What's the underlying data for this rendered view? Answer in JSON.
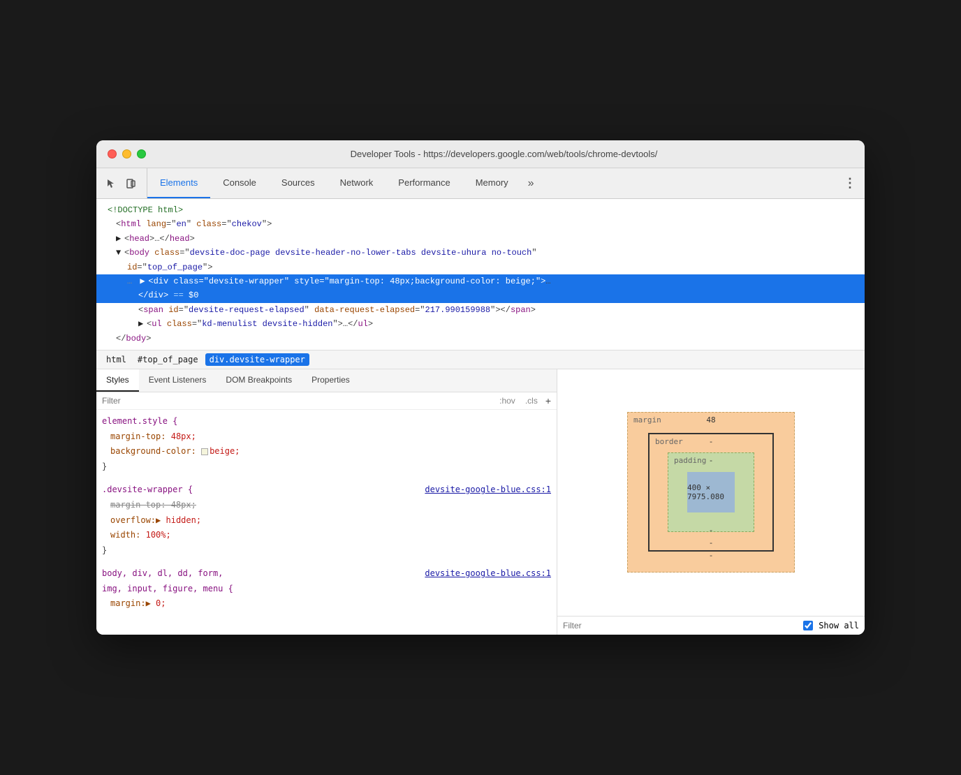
{
  "window": {
    "title": "Developer Tools - https://developers.google.com/web/tools/chrome-devtools/",
    "traffic_lights": [
      "close",
      "minimize",
      "maximize"
    ]
  },
  "toolbar": {
    "icons": [
      "cursor-icon",
      "device-icon"
    ],
    "tabs": [
      {
        "label": "Elements",
        "active": true
      },
      {
        "label": "Console",
        "active": false
      },
      {
        "label": "Sources",
        "active": false
      },
      {
        "label": "Network",
        "active": false
      },
      {
        "label": "Performance",
        "active": false
      },
      {
        "label": "Memory",
        "active": false
      }
    ],
    "more_label": "»",
    "menu_label": "⋮"
  },
  "dom": {
    "lines": [
      {
        "text": "<!DOCTYPE html>",
        "type": "comment",
        "indent": 0
      },
      {
        "text": "<html lang=\"en\" class=\"chekov\">",
        "type": "tag",
        "indent": 0
      },
      {
        "text": "▶<head>…</head>",
        "type": "collapsed",
        "indent": 1
      },
      {
        "text": "▼<body class=\"devsite-doc-page devsite-header-no-lower-tabs devsite-uhura no-touch\"",
        "type": "tag",
        "indent": 1
      },
      {
        "text": "id=\"top_of_page\">",
        "type": "tag-cont",
        "indent": 2
      },
      {
        "text": "▶<div class=\"devsite-wrapper\" style=\"margin-top: 48px;background-color: beige;\">…",
        "type": "selected",
        "indent": 2,
        "selected": true
      },
      {
        "text": "</div> == $0",
        "type": "selected-end",
        "indent": 3,
        "selected": true
      },
      {
        "text": "<span id=\"devsite-request-elapsed\" data-request-elapsed=\"217.990159988\"></span>",
        "type": "tag",
        "indent": 3
      },
      {
        "text": "▶<ul class=\"kd-menulist devsite-hidden\">…</ul>",
        "type": "collapsed",
        "indent": 3
      },
      {
        "text": "</body>",
        "type": "tag",
        "indent": 1
      }
    ]
  },
  "breadcrumb": {
    "items": [
      {
        "label": "html",
        "active": false
      },
      {
        "label": "#top_of_page",
        "active": false
      },
      {
        "label": "div.devsite-wrapper",
        "active": true
      }
    ]
  },
  "styles": {
    "panel_tabs": [
      "Styles",
      "Event Listeners",
      "DOM Breakpoints",
      "Properties"
    ],
    "active_tab": "Styles",
    "filter_placeholder": "Filter",
    "filter_options": [
      ":hov",
      ".cls",
      "+"
    ],
    "rules": [
      {
        "selector": "element.style {",
        "properties": [
          {
            "name": "margin-top:",
            "value": "48px;",
            "strikethrough": false,
            "color": null
          },
          {
            "name": "background-color:",
            "value": "beige;",
            "strikethrough": false,
            "color": "beige"
          }
        ],
        "source": null
      },
      {
        "selector": ".devsite-wrapper {",
        "source": "devsite-google-blue.css:1",
        "properties": [
          {
            "name": "margin-top:",
            "value": "48px;",
            "strikethrough": true,
            "color": null
          },
          {
            "name": "overflow:",
            "value": "hidden;",
            "strikethrough": false,
            "has_arrow": true,
            "color": null
          },
          {
            "name": "width:",
            "value": "100%;",
            "strikethrough": false,
            "color": null
          }
        ]
      },
      {
        "selector": "body, div, dl, dd, form,",
        "selector2": "img, input, figure, menu {",
        "source": "devsite-google-blue.css:1",
        "properties": [
          {
            "name": "margin:",
            "value": "▶ 0;",
            "strikethrough": false,
            "has_arrow": true,
            "color": null
          }
        ]
      }
    ]
  },
  "box_model": {
    "margin_label": "margin",
    "margin_value": "48",
    "border_label": "border",
    "border_value": "-",
    "padding_label": "padding",
    "padding_value": "-",
    "content_size": "400 × 7975.080",
    "bottom_value1": "-",
    "bottom_value2": "-",
    "bottom_value3": "-"
  },
  "computed": {
    "filter_placeholder": "Filter",
    "show_all_label": "Show all",
    "show_all_checked": true
  }
}
